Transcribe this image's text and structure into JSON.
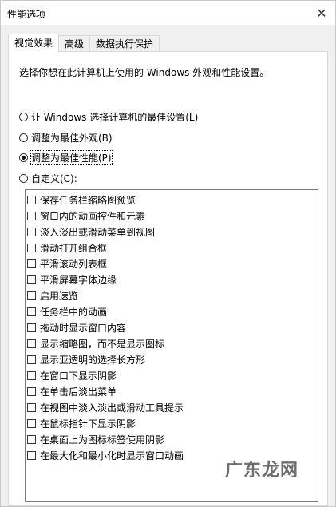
{
  "window": {
    "title": "性能选项",
    "close_symbol": "✕"
  },
  "tabs": [
    {
      "label": "视觉效果",
      "active": true
    },
    {
      "label": "高级",
      "active": false
    },
    {
      "label": "数据执行保护",
      "active": false
    }
  ],
  "description": "选择你想在此计算机上使用的 Windows 外观和性能设置。",
  "radio_options": [
    {
      "label": "让 Windows 选择计算机的最佳设置(L)",
      "checked": false
    },
    {
      "label": "调整为最佳外观(B)",
      "checked": false
    },
    {
      "label": "调整为最佳性能(P)",
      "checked": true
    },
    {
      "label": "自定义(C):",
      "checked": false
    }
  ],
  "effects": [
    {
      "label": "保存任务栏缩略图预览",
      "checked": false
    },
    {
      "label": "窗口内的动画控件和元素",
      "checked": false
    },
    {
      "label": "淡入淡出或滑动菜单到视图",
      "checked": false
    },
    {
      "label": "滑动打开组合框",
      "checked": false
    },
    {
      "label": "平滑滚动列表框",
      "checked": false
    },
    {
      "label": "平滑屏幕字体边缘",
      "checked": false
    },
    {
      "label": "启用速览",
      "checked": false
    },
    {
      "label": "任务栏中的动画",
      "checked": false
    },
    {
      "label": "拖动时显示窗口内容",
      "checked": false
    },
    {
      "label": "显示缩略图，而不是显示图标",
      "checked": false
    },
    {
      "label": "显示亚透明的选择长方形",
      "checked": false
    },
    {
      "label": "在窗口下显示阴影",
      "checked": false
    },
    {
      "label": "在单击后淡出菜单",
      "checked": false
    },
    {
      "label": "在视图中淡入淡出或滑动工具提示",
      "checked": false
    },
    {
      "label": "在鼠标指针下显示阴影",
      "checked": false
    },
    {
      "label": "在桌面上为图标标签使用阴影",
      "checked": false
    },
    {
      "label": "在最大化和最小化时显示窗口动画",
      "checked": false
    }
  ],
  "watermark": "广东龙网"
}
